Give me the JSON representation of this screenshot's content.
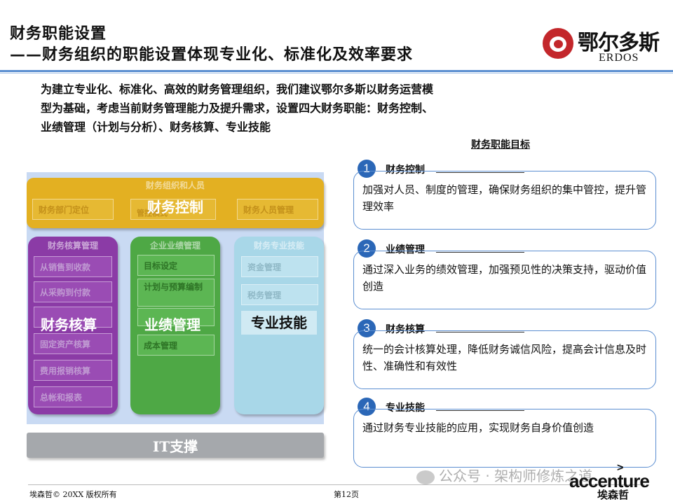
{
  "header": {
    "title": "财务职能设置",
    "subtitle": "——财务组织的职能设置体现专业化、标准化及效率要求"
  },
  "logo": {
    "cn": "鄂尔多斯",
    "en": "ERDOS"
  },
  "intro": {
    "lines": [
      "为建立专业化、标准化、高效的财务管理组织，我们建议鄂尔多斯以财务运营模",
      "型为基础，考虑当前财务管理能力及提升需求，设置四大财务职能：财务控制、",
      "业绩管理（计划与分析）、财务核算、专业技能"
    ]
  },
  "diagram": {
    "finance_control": {
      "faint_title": "财务组织和人员",
      "label": "财务控制",
      "items": [
        "财务部门定位",
        "管控模式",
        "财务人员管理"
      ]
    },
    "accounting": {
      "faint_title": "财务核算管理",
      "label": "财务核算",
      "items": [
        "从销售到收款",
        "从采购到付款",
        "",
        "固定资产核算",
        "费用报销核算",
        "总帐和报表"
      ]
    },
    "performance": {
      "faint_title": "企业业绩管理",
      "label": "业绩管理",
      "items": [
        "目标设定",
        "计划与预算编制",
        "",
        "成本管理"
      ]
    },
    "professional": {
      "faint_title": "财务专业技能",
      "label": "专业技能",
      "items": [
        "资金管理",
        "税务管理"
      ]
    },
    "it_label": "IT支撑"
  },
  "goals": {
    "title": "财务职能目标",
    "items": [
      {
        "num": "1",
        "label": "财务控制",
        "text": "加强对人员、制度的管理，确保财务组织的集中管控，提升管理效率"
      },
      {
        "num": "2",
        "label": "业绩管理",
        "text": "通过深入业务的绩效管理，加强预见性的决策支持，驱动价值创造"
      },
      {
        "num": "3",
        "label": "财务核算",
        "text": "统一的会计核算处理，降低财务诚信风险，提高会计信息及时性、准确性和有效性"
      },
      {
        "num": "4",
        "label": "专业技能",
        "text": "通过财务专业技能的应用，实现财务自身价值创造"
      }
    ]
  },
  "footer": {
    "copyright": "埃森哲© 20XX 版权所有",
    "page": "第12页",
    "watermark": "公众号 · 架构师修炼之道",
    "brand": "accenture",
    "brand_mark": ">",
    "brand_cn": "埃森哲"
  }
}
